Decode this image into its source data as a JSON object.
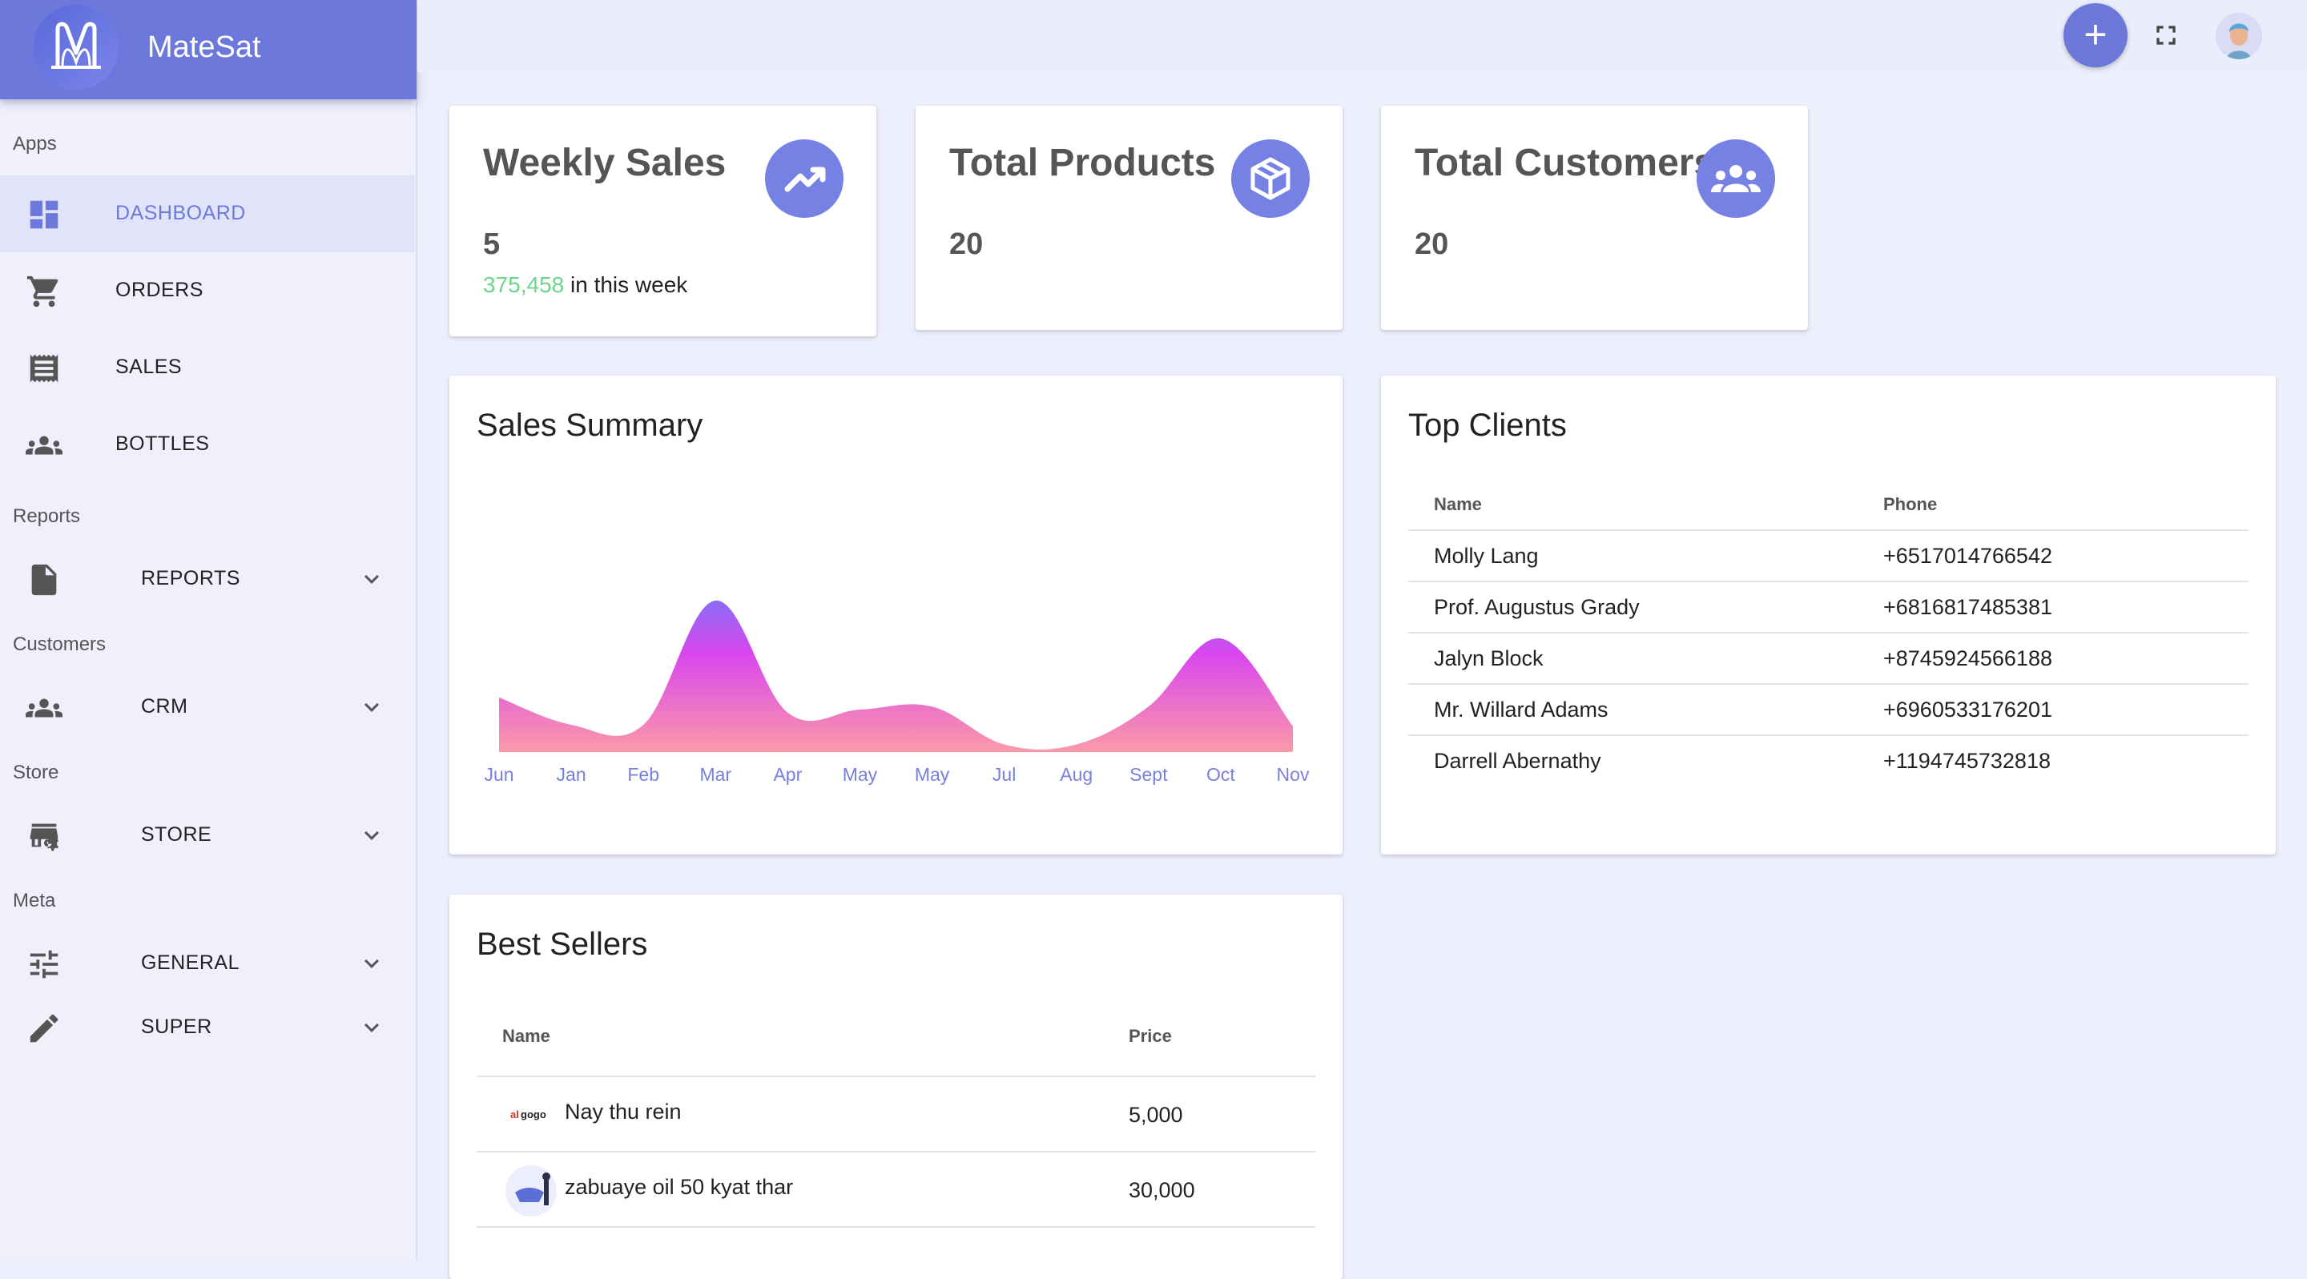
{
  "app": {
    "title": "MateSat"
  },
  "sidebar": {
    "sections": {
      "apps": "Apps",
      "reports": "Reports",
      "customers": "Customers",
      "store": "Store",
      "meta": "Meta"
    },
    "items": [
      {
        "label": "DASHBOARD",
        "icon": "dashboard-icon",
        "active": true
      },
      {
        "label": "ORDERS",
        "icon": "cart-icon"
      },
      {
        "label": "SALES",
        "icon": "receipt-icon"
      },
      {
        "label": "BOTTLES",
        "icon": "people-icon"
      },
      {
        "label": "REPORTS",
        "icon": "file-icon",
        "expandable": true
      },
      {
        "label": "CRM",
        "icon": "people-icon",
        "expandable": true
      },
      {
        "label": "STORE",
        "icon": "store-settings-icon",
        "expandable": true
      },
      {
        "label": "GENERAL",
        "icon": "sliders-icon",
        "expandable": true
      },
      {
        "label": "SUPER",
        "icon": "pencil-icon",
        "expandable": true
      }
    ]
  },
  "topbar": {
    "add_label": "+"
  },
  "stats": [
    {
      "name": "Weekly Sales",
      "value": "5",
      "sub_value": "375,458",
      "sub_text": " in this week",
      "icon": "trending-up-icon"
    },
    {
      "name": "Total Products",
      "value": "20",
      "icon": "box-icon"
    },
    {
      "name": "Total Customers",
      "value": "20",
      "icon": "group-icon"
    }
  ],
  "sales_summary": {
    "title": "Sales Summary"
  },
  "chart_data": {
    "type": "area",
    "title": "Sales Summary",
    "categories": [
      "Jun",
      "Jan",
      "Feb",
      "Mar",
      "Apr",
      "May",
      "May",
      "Jul",
      "Aug",
      "Sept",
      "Oct",
      "Nov"
    ],
    "series": [
      {
        "values": [
          36,
          18,
          18,
          100,
          26,
          28,
          30,
          5,
          5,
          30,
          75,
          17
        ]
      }
    ],
    "xlabel": "",
    "ylabel": "",
    "ylim": [
      0,
      110
    ],
    "grid": false,
    "colors": {
      "top": "#d946ef",
      "bottom": "#fb9aa8",
      "peak": "#8b6cf5"
    }
  },
  "top_clients": {
    "title": "Top Clients",
    "columns": [
      "Name",
      "Phone"
    ],
    "rows": [
      [
        "Molly Lang",
        "+6517014766542"
      ],
      [
        "Prof. Augustus Grady",
        "+6816817485381"
      ],
      [
        "Jalyn Block",
        "+8745924566188"
      ],
      [
        "Mr. Willard Adams",
        "+6960533176201"
      ],
      [
        "Darrell Abernathy",
        "+1194745732818"
      ]
    ]
  },
  "best_sellers": {
    "title": "Best Sellers",
    "columns": [
      "Name",
      "Price"
    ],
    "rows": [
      {
        "name": "Nay thu rein",
        "price": "5,000",
        "thumb": "algogo-logo"
      },
      {
        "name": "zabuaye oil 50 kyat thar",
        "price": "30,000",
        "thumb": "product-illustration"
      }
    ]
  },
  "colors": {
    "accent": "#6c79db",
    "positive": "#6cd48b"
  }
}
